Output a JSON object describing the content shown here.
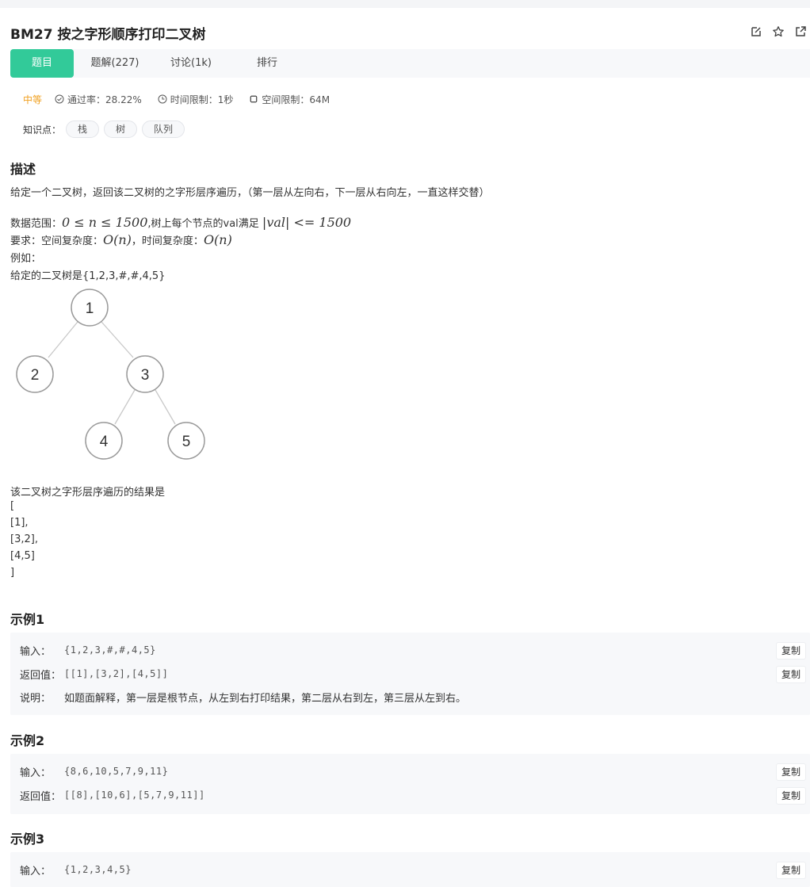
{
  "title": "BM27  按之字形顺序打印二叉树",
  "title_icons": [
    "edit-icon",
    "star-icon",
    "share-icon"
  ],
  "tabs": [
    {
      "label": "题目",
      "active": true
    },
    {
      "label": "题解(227)"
    },
    {
      "label": "讨论(1k)"
    },
    {
      "label": "排行"
    }
  ],
  "meta": {
    "difficulty": "中等",
    "pass_rate": "通过率：28.22%",
    "time_limit": "时间限制：1秒",
    "space_limit": "空间限制：64M"
  },
  "knowledge": {
    "label": "知识点：",
    "tags": [
      "栈",
      "树",
      "队列"
    ]
  },
  "description": {
    "heading": "描述",
    "intro": "给定一个二叉树，返回该二叉树的之字形层序遍历，（第一层从左向右，下一层从右向左，一直这样交替）",
    "range_prefix": "数据范围：",
    "range_math": "0 ≤ n ≤ 1500",
    "range_mid": ",树上每个节点的val满足 ",
    "range_math2": "|val| <= 1500",
    "req_prefix": "要求：空间复杂度：",
    "req_math1": "O(n)",
    "req_mid": "，时间复杂度：",
    "req_math2": "O(n)",
    "example_label": "例如：",
    "given_tree": "给定的二叉树是{1,2,3,#,#,4,5}",
    "tree_nodes": [
      "1",
      "2",
      "3",
      "4",
      "5"
    ],
    "result_intro": "该二叉树之字形层序遍历的结果是",
    "result_lines": [
      "[",
      "[1],",
      "[3,2],",
      "[4,5]",
      "]"
    ]
  },
  "examples": [
    {
      "heading": "示例1",
      "input_label": "输入：",
      "input": "{1,2,3,#,#,4,5}",
      "output_label": "返回值：",
      "output": "[[1],[3,2],[4,5]]",
      "note_label": "说明：",
      "note": "如题面解释，第一层是根节点，从左到右打印结果，第二层从右到左，第三层从左到右。",
      "copy": "复制"
    },
    {
      "heading": "示例2",
      "input_label": "输入：",
      "input": "{8,6,10,5,7,9,11}",
      "output_label": "返回值：",
      "output": "[[8],[10,6],[5,7,9,11]]",
      "copy": "复制"
    },
    {
      "heading": "示例3",
      "input_label": "输入：",
      "input": "{1,2,3,4,5}",
      "copy": "复制"
    }
  ],
  "colors": {
    "accent": "#32ca99",
    "difficulty": "#f0a020",
    "panel": "#f7f8fa"
  }
}
